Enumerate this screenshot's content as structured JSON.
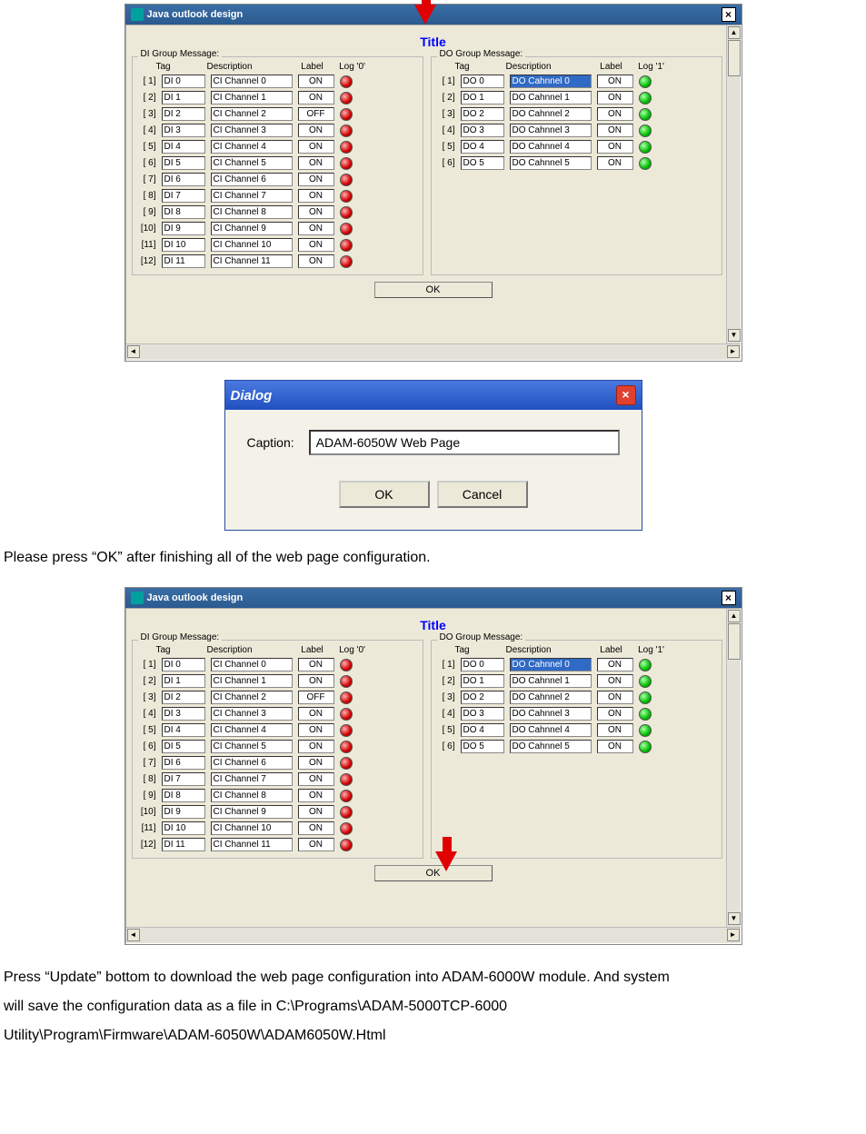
{
  "figure1": {
    "win_title": "Java outlook design",
    "title_label": "Title",
    "di_legend": "DI Group Message:",
    "do_legend": "DO Group Message:",
    "hdr": {
      "tag": "Tag",
      "desc": "Description",
      "label": "Label",
      "di_log": "Log '0'",
      "do_log": "Log '1'"
    },
    "di_rows": [
      {
        "idx": "[ 1]",
        "tag": "DI 0",
        "desc": "CI Channel 0",
        "label": "ON"
      },
      {
        "idx": "[ 2]",
        "tag": "DI 1",
        "desc": "CI Channel 1",
        "label": "ON"
      },
      {
        "idx": "[ 3]",
        "tag": "DI 2",
        "desc": "CI Channel 2",
        "label": "OFF"
      },
      {
        "idx": "[ 4]",
        "tag": "DI 3",
        "desc": "CI Channel 3",
        "label": "ON"
      },
      {
        "idx": "[ 5]",
        "tag": "DI 4",
        "desc": "CI Channel 4",
        "label": "ON"
      },
      {
        "idx": "[ 6]",
        "tag": "DI 5",
        "desc": "CI Channel 5",
        "label": "ON"
      },
      {
        "idx": "[ 7]",
        "tag": "DI 6",
        "desc": "CI Channel 6",
        "label": "ON"
      },
      {
        "idx": "[ 8]",
        "tag": "DI 7",
        "desc": "CI Channel 7",
        "label": "ON"
      },
      {
        "idx": "[ 9]",
        "tag": "DI 8",
        "desc": "CI Channel 8",
        "label": "ON"
      },
      {
        "idx": "[10]",
        "tag": "DI 9",
        "desc": "CI Channel 9",
        "label": "ON"
      },
      {
        "idx": "[11]",
        "tag": "DI 10",
        "desc": "CI Channel 10",
        "label": "ON"
      },
      {
        "idx": "[12]",
        "tag": "DI 11",
        "desc": "CI Channel 11",
        "label": "ON"
      }
    ],
    "do_rows": [
      {
        "idx": "[ 1]",
        "tag": "DO 0",
        "desc": "DO Cahnnel 0",
        "label": "ON",
        "sel": true
      },
      {
        "idx": "[ 2]",
        "tag": "DO 1",
        "desc": "DO Cahnnel 1",
        "label": "ON"
      },
      {
        "idx": "[ 3]",
        "tag": "DO 2",
        "desc": "DO Cahnnel 2",
        "label": "ON"
      },
      {
        "idx": "[ 4]",
        "tag": "DO 3",
        "desc": "DO Cahnnel 3",
        "label": "ON"
      },
      {
        "idx": "[ 5]",
        "tag": "DO 4",
        "desc": "DO Cahnnel 4",
        "label": "ON"
      },
      {
        "idx": "[ 6]",
        "tag": "DO 5",
        "desc": "DO Cahnnel 5",
        "label": "ON"
      }
    ],
    "ok_label": "OK"
  },
  "dialog": {
    "title": "Dialog",
    "caption_label": "Caption:",
    "caption_value": "ADAM-6050W Web Page",
    "ok": "OK",
    "cancel": "Cancel"
  },
  "text1": "Please press “OK” after finishing all of the web page configuration.",
  "text2a": "Press “Update” bottom to download the web page configuration into ADAM-6000W module. And system",
  "text2b": "will save the configuration data as a file in C:\\Programs\\ADAM-5000TCP-6000",
  "text2c": "Utility\\Program\\Firmware\\ADAM-6050W\\ADAM6050W.Html"
}
